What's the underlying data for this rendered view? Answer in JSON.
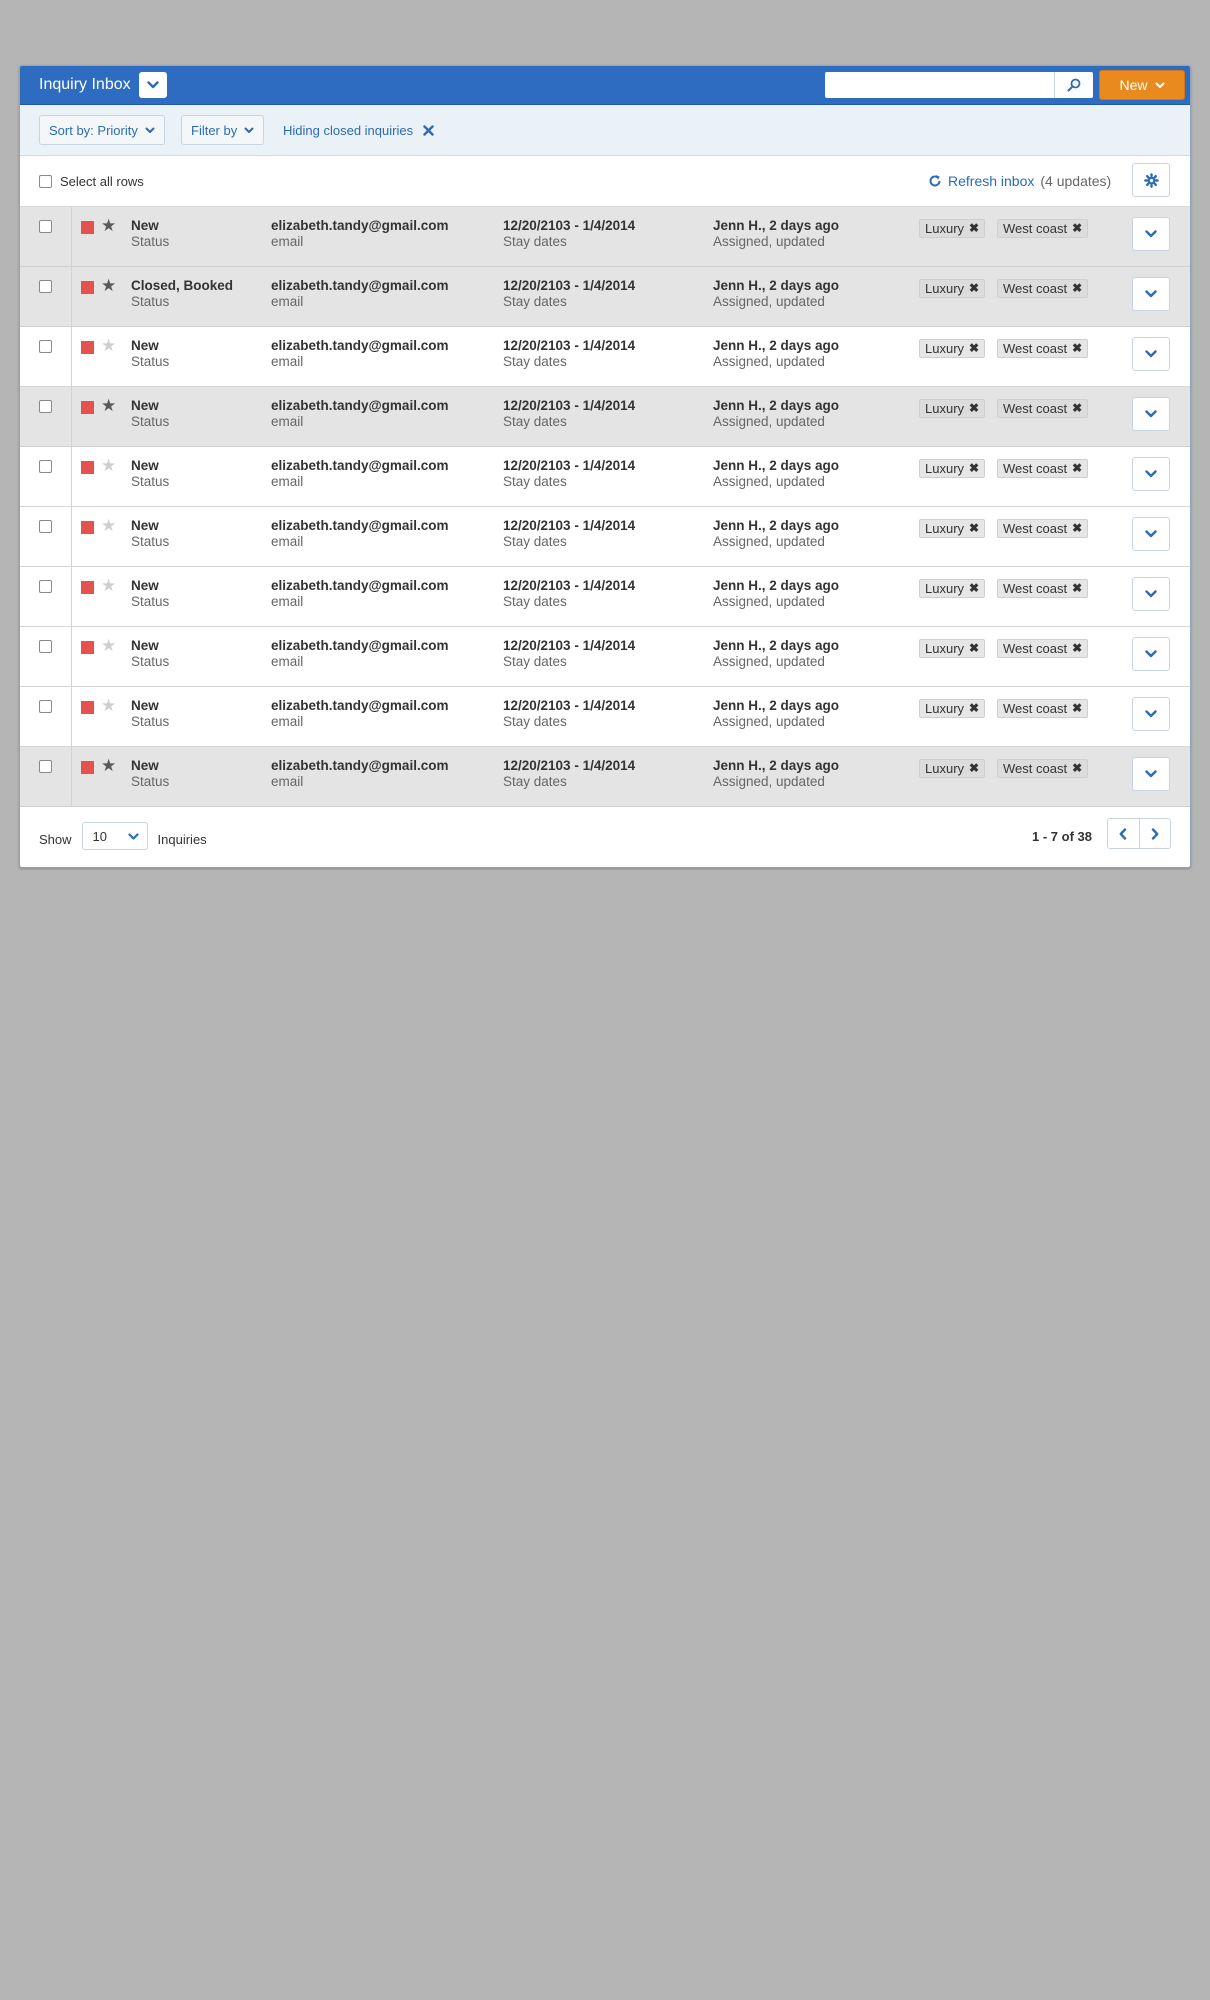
{
  "colors": {
    "background": "#b5b5b5",
    "header": "#2d6cc0",
    "accent": "#2b6cb3",
    "new_button": "#e98a1f",
    "priority_flag": "#e5514d"
  },
  "header": {
    "title": "Inquiry Inbox",
    "search_placeholder": "",
    "new_label": "New"
  },
  "filters": {
    "sort_label": "Sort by: Priority",
    "filter_label": "Filter by",
    "hiding_label": "Hiding closed inquiries"
  },
  "toolbar": {
    "select_all_label": "Select all rows",
    "refresh_label": "Refresh inbox",
    "refresh_count": "(4 updates)"
  },
  "rows": [
    {
      "starred": true,
      "shaded": true,
      "status": "New",
      "status_label": "Status",
      "email": "elizabeth.tandy@gmail.com",
      "email_label": "email",
      "dates": "12/20/2103 - 1/4/2014",
      "dates_label": "Stay dates",
      "assigned": "Jenn H., 2 days ago",
      "assigned_label": "Assigned, updated",
      "tags": [
        "Luxury",
        "West coast"
      ]
    },
    {
      "starred": true,
      "shaded": true,
      "status": "Closed, Booked",
      "status_label": "Status",
      "email": "elizabeth.tandy@gmail.com",
      "email_label": "email",
      "dates": "12/20/2103 - 1/4/2014",
      "dates_label": "Stay dates",
      "assigned": "Jenn H., 2 days ago",
      "assigned_label": "Assigned, updated",
      "tags": [
        "Luxury",
        "West coast"
      ]
    },
    {
      "starred": false,
      "shaded": false,
      "status": "New",
      "status_label": "Status",
      "email": "elizabeth.tandy@gmail.com",
      "email_label": "email",
      "dates": "12/20/2103 - 1/4/2014",
      "dates_label": "Stay dates",
      "assigned": "Jenn H., 2 days ago",
      "assigned_label": "Assigned, updated",
      "tags": [
        "Luxury",
        "West coast"
      ]
    },
    {
      "starred": true,
      "shaded": true,
      "status": "New",
      "status_label": "Status",
      "email": "elizabeth.tandy@gmail.com",
      "email_label": "email",
      "dates": "12/20/2103 - 1/4/2014",
      "dates_label": "Stay dates",
      "assigned": "Jenn H., 2 days ago",
      "assigned_label": "Assigned, updated",
      "tags": [
        "Luxury",
        "West coast"
      ]
    },
    {
      "starred": false,
      "shaded": false,
      "status": "New",
      "status_label": "Status",
      "email": "elizabeth.tandy@gmail.com",
      "email_label": "email",
      "dates": "12/20/2103 - 1/4/2014",
      "dates_label": "Stay dates",
      "assigned": "Jenn H., 2 days ago",
      "assigned_label": "Assigned, updated",
      "tags": [
        "Luxury",
        "West coast"
      ]
    },
    {
      "starred": false,
      "shaded": false,
      "status": "New",
      "status_label": "Status",
      "email": "elizabeth.tandy@gmail.com",
      "email_label": "email",
      "dates": "12/20/2103 - 1/4/2014",
      "dates_label": "Stay dates",
      "assigned": "Jenn H., 2 days ago",
      "assigned_label": "Assigned, updated",
      "tags": [
        "Luxury",
        "West coast"
      ]
    },
    {
      "starred": false,
      "shaded": false,
      "status": "New",
      "status_label": "Status",
      "email": "elizabeth.tandy@gmail.com",
      "email_label": "email",
      "dates": "12/20/2103 - 1/4/2014",
      "dates_label": "Stay dates",
      "assigned": "Jenn H., 2 days ago",
      "assigned_label": "Assigned, updated",
      "tags": [
        "Luxury",
        "West coast"
      ]
    },
    {
      "starred": false,
      "shaded": false,
      "status": "New",
      "status_label": "Status",
      "email": "elizabeth.tandy@gmail.com",
      "email_label": "email",
      "dates": "12/20/2103 - 1/4/2014",
      "dates_label": "Stay dates",
      "assigned": "Jenn H., 2 days ago",
      "assigned_label": "Assigned, updated",
      "tags": [
        "Luxury",
        "West coast"
      ]
    },
    {
      "starred": false,
      "shaded": false,
      "status": "New",
      "status_label": "Status",
      "email": "elizabeth.tandy@gmail.com",
      "email_label": "email",
      "dates": "12/20/2103 - 1/4/2014",
      "dates_label": "Stay dates",
      "assigned": "Jenn H., 2 days ago",
      "assigned_label": "Assigned, updated",
      "tags": [
        "Luxury",
        "West coast"
      ]
    },
    {
      "starred": true,
      "shaded": true,
      "status": "New",
      "status_label": "Status",
      "email": "elizabeth.tandy@gmail.com",
      "email_label": "email",
      "dates": "12/20/2103 - 1/4/2014",
      "dates_label": "Stay dates",
      "assigned": "Jenn H., 2 days ago",
      "assigned_label": "Assigned, updated",
      "tags": [
        "Luxury",
        "West coast"
      ]
    }
  ],
  "footer": {
    "show_label": "Show",
    "page_size": "10",
    "inquiries_label": "Inquiries",
    "range_label": "1 - 7 of 38"
  },
  "icons": {
    "chevron": "chevron-down-icon",
    "search": "search-icon",
    "refresh": "refresh-icon",
    "gear": "gear-icon",
    "close": "close-icon",
    "star": "star-icon",
    "flag": "priority-flag-icon"
  }
}
